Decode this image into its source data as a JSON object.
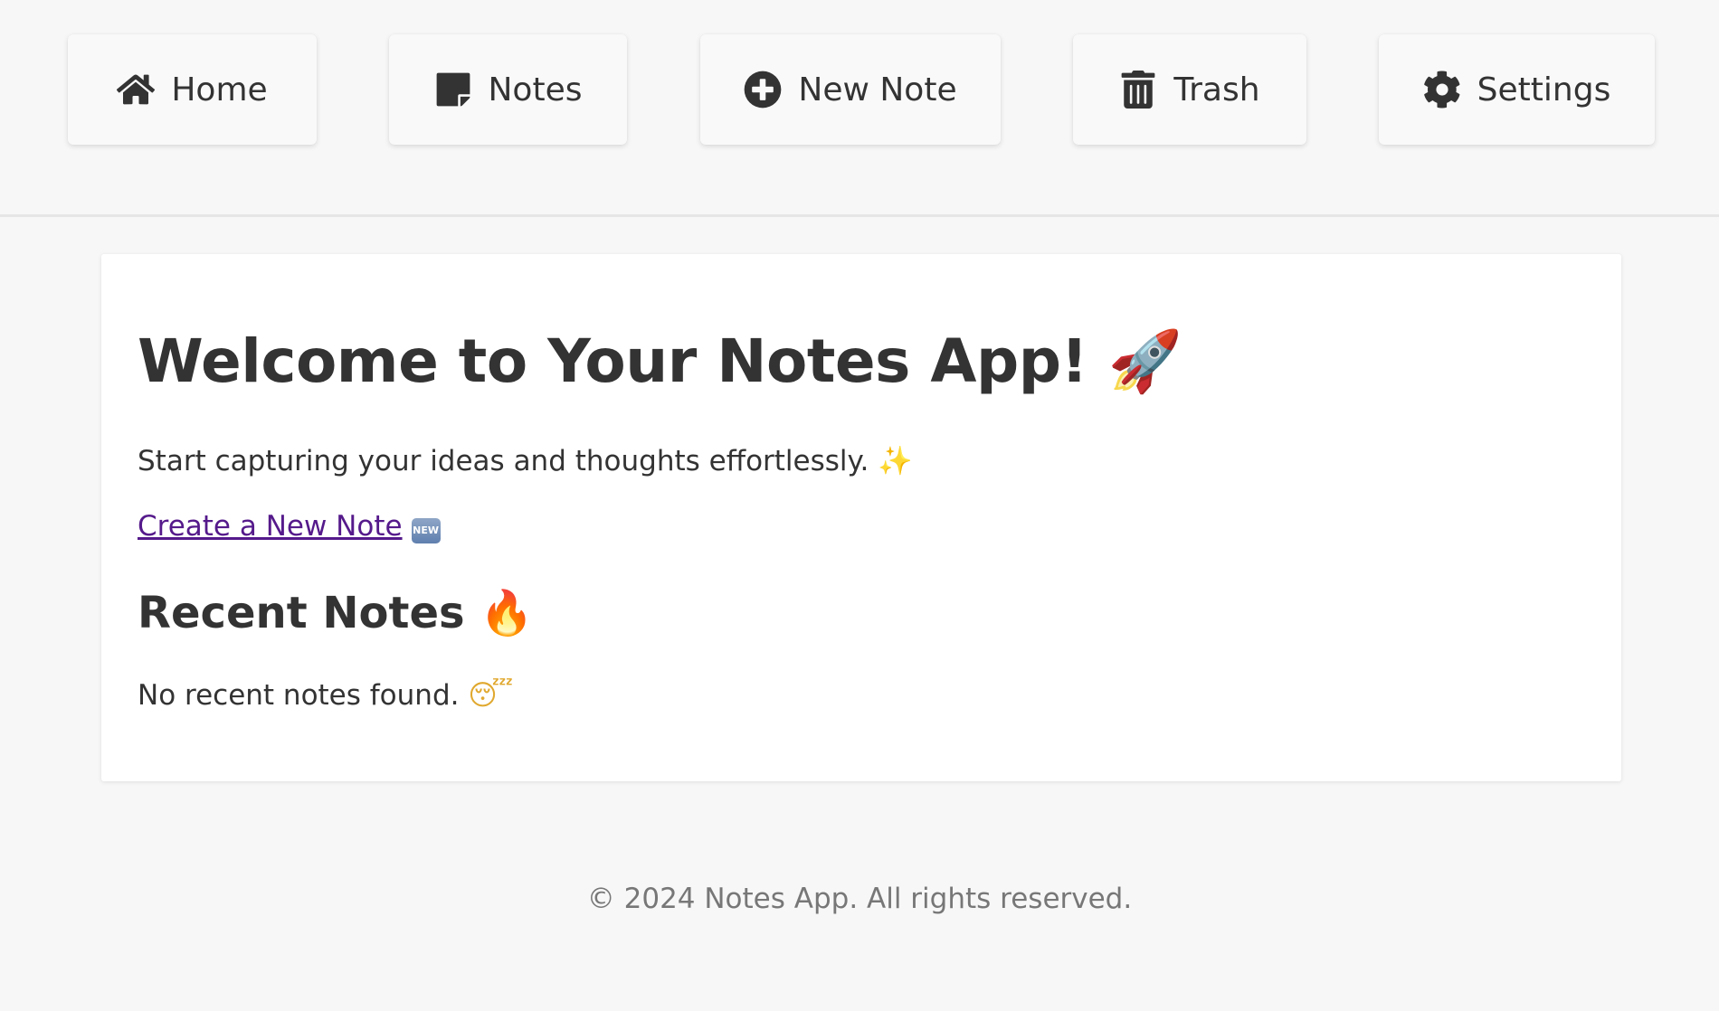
{
  "nav": {
    "home": {
      "label": "Home",
      "icon": "home-icon"
    },
    "notes": {
      "label": "Notes",
      "icon": "sticky-note-icon"
    },
    "new_note": {
      "label": "New Note",
      "icon": "plus-circle-icon"
    },
    "trash": {
      "label": "Trash",
      "icon": "trash-icon"
    },
    "settings": {
      "label": "Settings",
      "icon": "gear-icon"
    }
  },
  "main": {
    "title": "Welcome to Your Notes App!",
    "title_emoji": "🚀",
    "intro": "Start capturing your ideas and thoughts effortlessly.",
    "intro_emoji": "✨",
    "create_link": "Create a New Note",
    "create_link_badge": "NEW",
    "recent_heading": "Recent Notes",
    "recent_emoji": "🔥",
    "empty_message": "No recent notes found.",
    "empty_emoji": "😴"
  },
  "footer": {
    "text": "© 2024 Notes App. All rights reserved."
  },
  "colors": {
    "background": "#f7f7f7",
    "card": "#ffffff",
    "text": "#333333",
    "link_visited": "#551a8b",
    "footer_text": "#777777"
  }
}
